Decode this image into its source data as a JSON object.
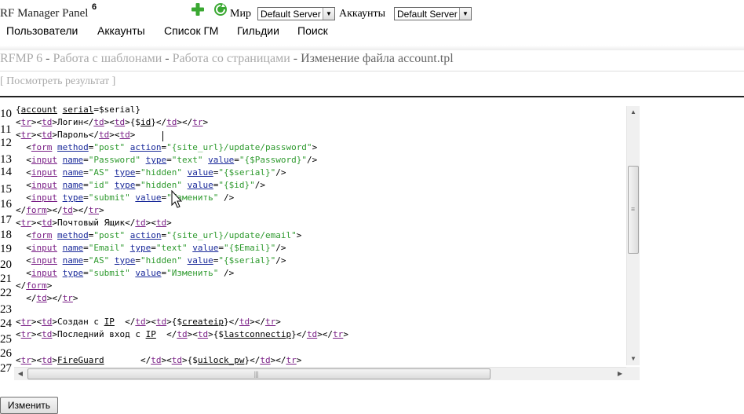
{
  "header": {
    "title": "RF Manager Panel",
    "version": "6",
    "world_label": "Мир",
    "world_value": "Default Server",
    "accounts_label": "Аккаунты",
    "accounts_value": "Default Server",
    "icons": [
      "add-icon",
      "refresh-icon"
    ]
  },
  "menu": [
    {
      "label": "Пользователи"
    },
    {
      "label": "Аккаунты"
    },
    {
      "label": "Список ГМ"
    },
    {
      "label": "Гильдии"
    },
    {
      "label": "Поиск"
    }
  ],
  "breadcrumb": {
    "root": "RFMP 6",
    "sep": "-",
    "item1": "Работа с шаблонами",
    "item2": "Работа со страницами",
    "current": "Изменение файла account.tpl"
  },
  "preview_link": "[ Посмотреть результат ]",
  "editor": {
    "line_numbers": [
      "10",
      "11",
      "12",
      "13",
      "14",
      "15",
      "16",
      "17",
      "18",
      "19",
      "20",
      "21",
      "22",
      "23",
      "24",
      "25",
      "26",
      "27"
    ]
  },
  "submit_label": "Изменить",
  "colors": {
    "tag": "#7a1f86",
    "attr": "#1a2a9a",
    "string": "#2e9a2e",
    "breadcrumb_link": "#aaaaaa"
  }
}
